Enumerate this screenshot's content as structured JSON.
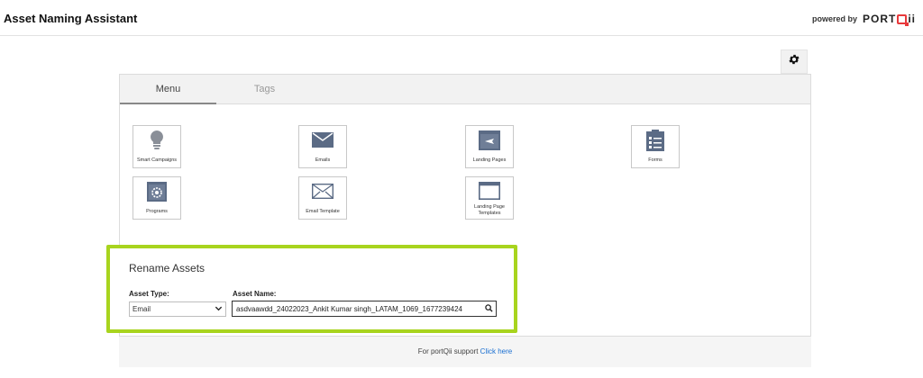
{
  "app": {
    "title": "Asset Naming Assistant",
    "powered_by": "powered by",
    "brand_left": "PORT",
    "brand_right": "ii",
    "brand_color": "#e8393b"
  },
  "tabs": [
    {
      "label": "Menu",
      "active": true
    },
    {
      "label": "Tags",
      "active": false
    }
  ],
  "tiles": [
    {
      "label": "Smart Campaigns",
      "icon": "lightbulb-icon"
    },
    {
      "label": "Emails",
      "icon": "envelope-icon"
    },
    {
      "label": "Landing Pages",
      "icon": "landing-page-icon"
    },
    {
      "label": "Forms",
      "icon": "clipboard-list-icon"
    },
    {
      "label": "Programs",
      "icon": "program-gear-icon"
    },
    {
      "label": "Email Template",
      "icon": "envelope-outline-icon"
    },
    {
      "label": "Landing Page Templates",
      "icon": "window-template-icon"
    }
  ],
  "rename": {
    "title": "Rename Assets",
    "asset_type_label": "Asset Type:",
    "asset_type_value": "Email",
    "asset_name_label": "Asset Name:",
    "asset_name_value": "asdvaawdd_24022023_Ankit Kumar singh_LATAM_1069_1677239424",
    "highlight_color": "#a8d41e"
  },
  "footer": {
    "text": "For portQii support",
    "link": "Click here"
  }
}
